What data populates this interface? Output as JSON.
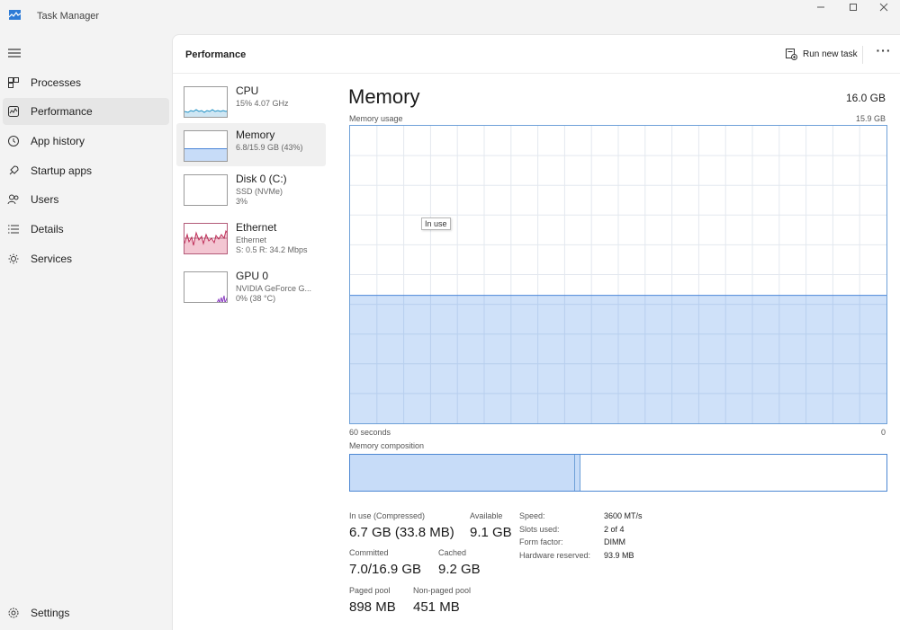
{
  "window": {
    "title": "Task Manager"
  },
  "nav": {
    "items": [
      {
        "label": "Processes",
        "icon": "processes-icon"
      },
      {
        "label": "Performance",
        "icon": "performance-icon"
      },
      {
        "label": "App history",
        "icon": "app-history-icon"
      },
      {
        "label": "Startup apps",
        "icon": "startup-apps-icon"
      },
      {
        "label": "Users",
        "icon": "users-icon"
      },
      {
        "label": "Details",
        "icon": "details-icon"
      },
      {
        "label": "Services",
        "icon": "services-icon"
      }
    ],
    "active": "Performance",
    "settings_label": "Settings"
  },
  "header": {
    "title": "Performance",
    "run_new_task": "Run new task",
    "more_label": "···"
  },
  "devices": [
    {
      "name": "CPU",
      "line1": "15%  4.07 GHz",
      "line2": "",
      "color": "#1b8fc4"
    },
    {
      "name": "Memory",
      "line1": "6.8/15.9 GB (43%)",
      "line2": "",
      "color": "#4a84d8"
    },
    {
      "name": "Disk 0 (C:)",
      "line1": "SSD (NVMe)",
      "line2": "3%",
      "color": "#46a046"
    },
    {
      "name": "Ethernet",
      "line1": "Ethernet",
      "line2": "S: 0.5  R: 34.2 Mbps",
      "color": "#c0305a"
    },
    {
      "name": "GPU 0",
      "line1": "NVIDIA GeForce G...",
      "line2": "0% (38 °C)",
      "color": "#8a3cc0"
    }
  ],
  "memory": {
    "title": "Memory",
    "total": "16.0 GB",
    "usage_label": "Memory usage",
    "usage_max": "15.9 GB",
    "in_use_tooltip": "In use",
    "time_left": "60 seconds",
    "time_right": "0",
    "composition_label": "Memory composition",
    "usage_fraction": 0.43,
    "composition": {
      "in_use_fraction": 0.42,
      "modified_fraction": 0.01
    },
    "stats": {
      "in_use_label": "In use (Compressed)",
      "in_use_value": "6.7 GB (33.8 MB)",
      "available_label": "Available",
      "available_value": "9.1 GB",
      "committed_label": "Committed",
      "committed_value": "7.0/16.9 GB",
      "cached_label": "Cached",
      "cached_value": "9.2 GB",
      "paged_label": "Paged pool",
      "paged_value": "898 MB",
      "nonpaged_label": "Non-paged pool",
      "nonpaged_value": "451 MB"
    },
    "specs": [
      {
        "label": "Speed:",
        "value": "3600 MT/s"
      },
      {
        "label": "Slots used:",
        "value": "2 of 4"
      },
      {
        "label": "Form factor:",
        "value": "DIMM"
      },
      {
        "label": "Hardware reserved:",
        "value": "93.9 MB"
      }
    ]
  },
  "colors": {
    "memory_fill": "#c7dcf8",
    "memory_line": "#4a84d8",
    "ethernet_fill": "#f3c6d2"
  }
}
